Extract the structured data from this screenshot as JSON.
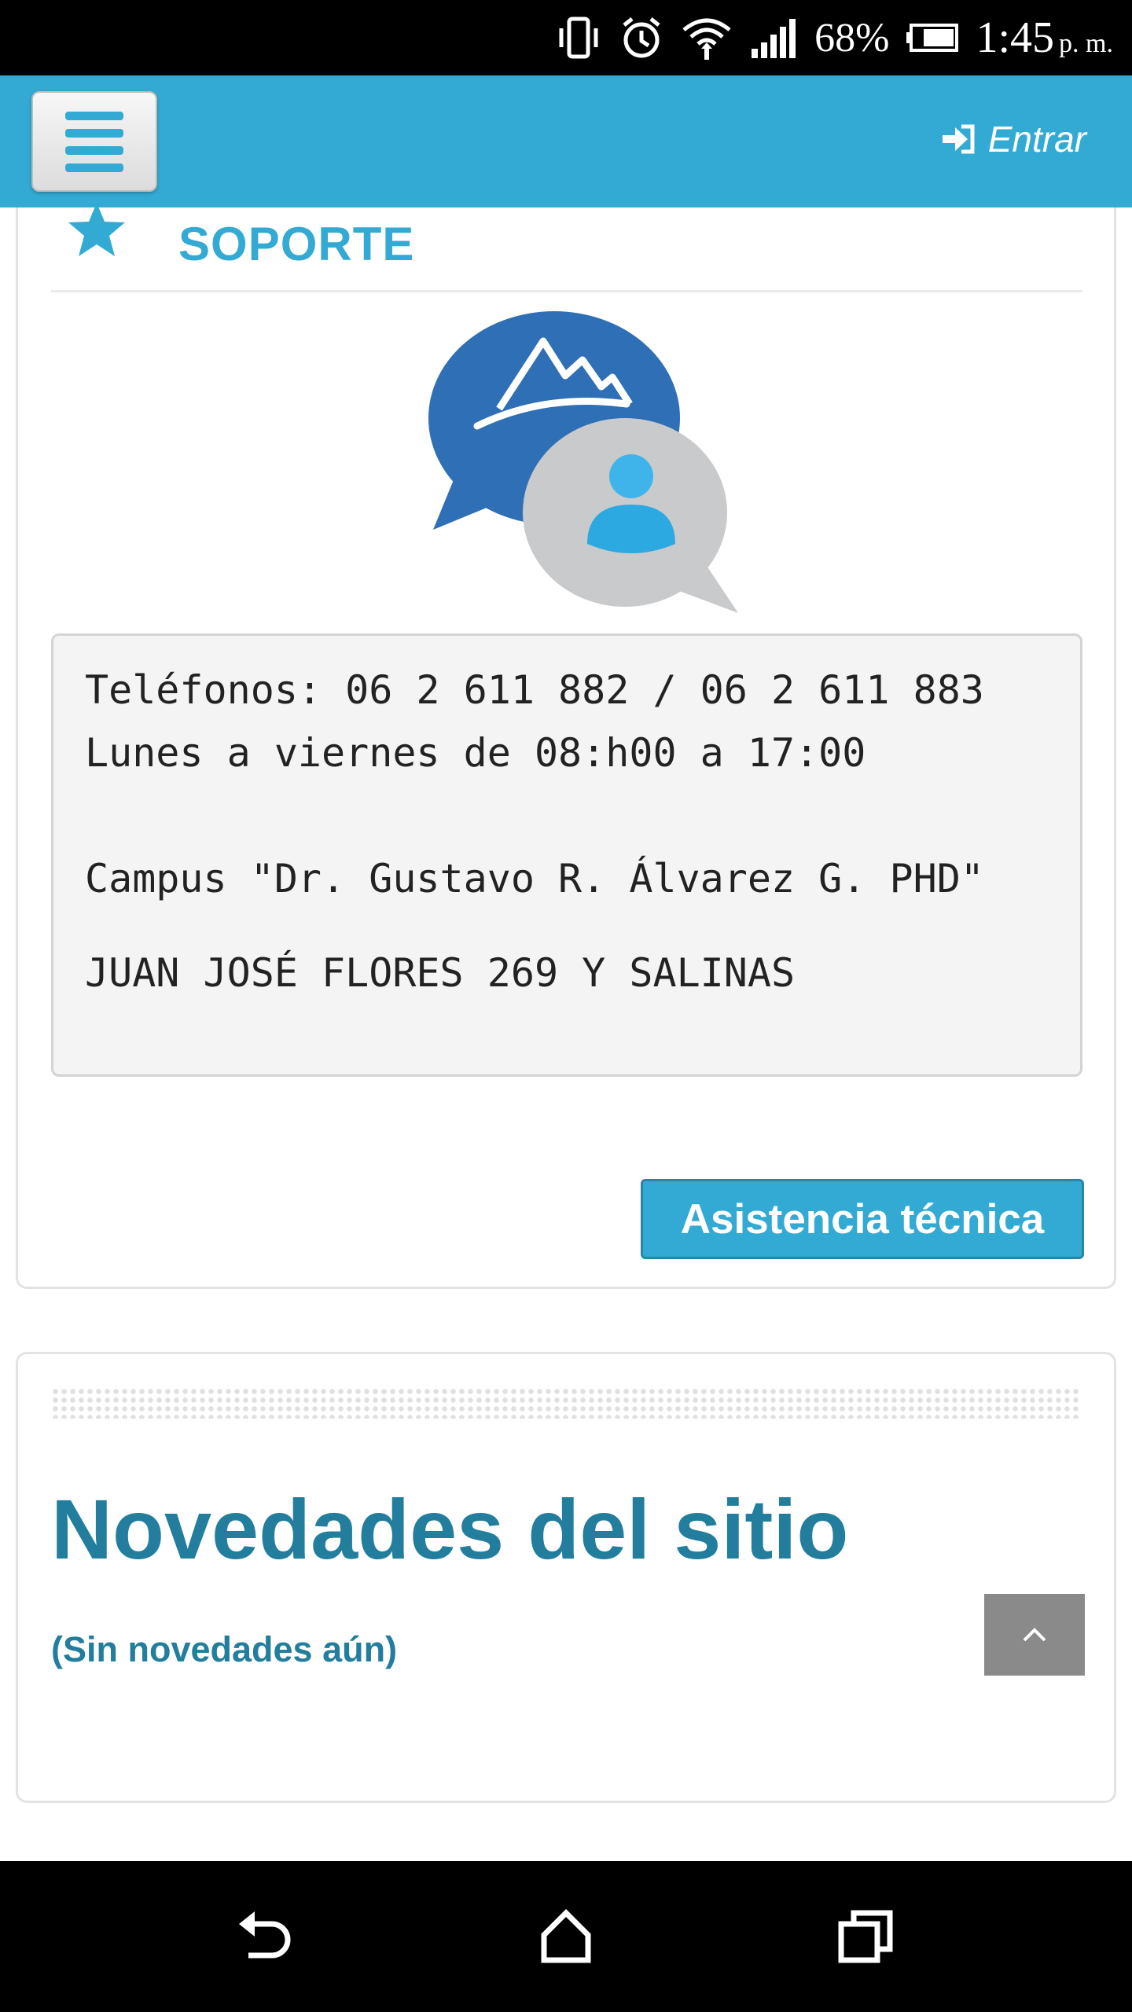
{
  "status_bar": {
    "battery_percent": "68%",
    "time": "1:45",
    "ampm": "p. m.",
    "icons": [
      "vibrate-icon",
      "alarm-icon",
      "wifi-icon",
      "signal-icon",
      "battery-icon"
    ]
  },
  "header": {
    "login_label": "Entrar",
    "menu_icon": "hamburger-icon",
    "login_icon": "sign-in-icon"
  },
  "support": {
    "title": "SOPORTE",
    "title_icon": "star-icon",
    "logo_icon": "chat-support-logo",
    "phones": "Teléfonos: 06 2 611 882 / 06 2 611 883",
    "hours": "Lunes a viernes de 08:h00 a 17:00",
    "campus": "Campus \"Dr. Gustavo R. Álvarez G. PHD\"",
    "address": "JUAN JOSÉ FLORES 269 Y SALINAS",
    "button_label": "Asistencia técnica"
  },
  "news": {
    "title": "Novedades del sitio",
    "empty_text": "(Sin novedades aún)"
  },
  "colors": {
    "accent": "#33aad3",
    "heading": "#227e9c",
    "scroll_button": "#8a8a8a"
  },
  "scroll_button_icon": "chevron-up-icon",
  "nav_icons": [
    "back-icon",
    "home-icon",
    "recents-icon"
  ]
}
